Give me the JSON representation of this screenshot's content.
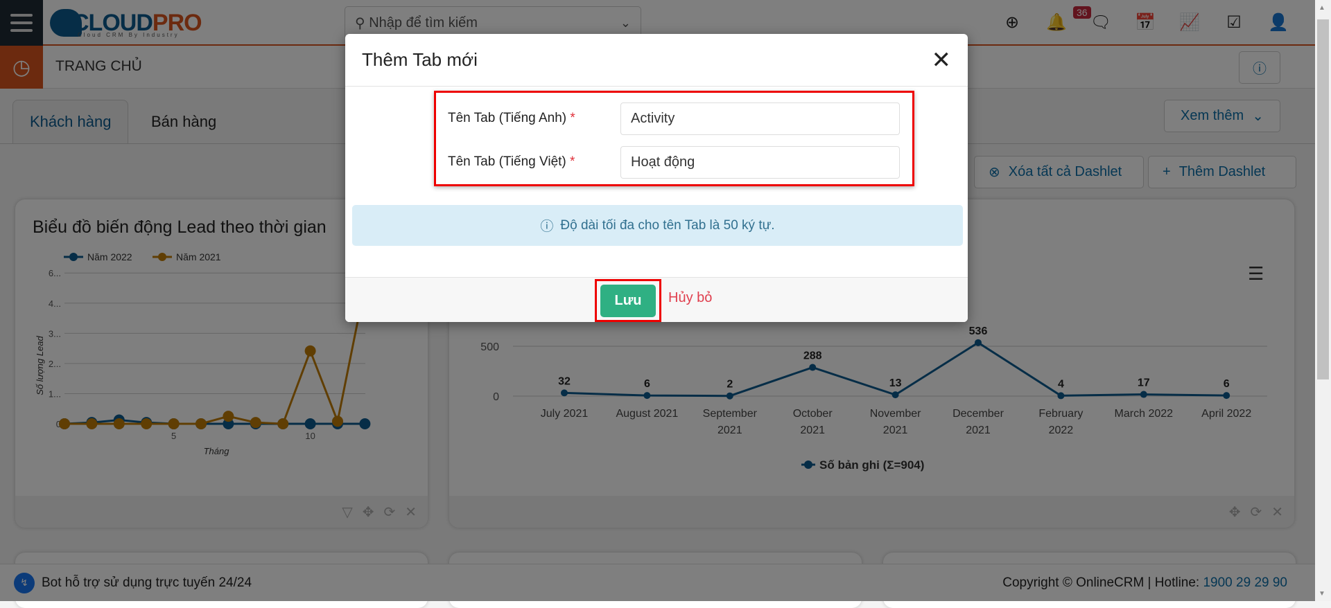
{
  "header": {
    "search_placeholder": "Nhập để tìm kiếm",
    "logo_text_1": "CLOUD",
    "logo_text_2": "PRO",
    "logo_sub": "Cloud CRM By Industry",
    "notification_count": "36",
    "icons": [
      "plus-circle-icon",
      "bell-icon",
      "chat-icon",
      "calendar-icon",
      "report-chart-icon",
      "task-check-icon",
      "user-icon"
    ]
  },
  "page": {
    "title": "TRANG CHỦ",
    "tabs": [
      {
        "label": "Khách hàng",
        "active": true
      },
      {
        "label": "Bán hàng",
        "active": false
      }
    ],
    "more_label": "Xem thêm",
    "clear_dashlets": "Xóa tất cả Dashlet",
    "add_dashlet": "Thêm Dashlet"
  },
  "left_dashlet": {
    "title": "Biểu đồ biến động Lead theo thời gian"
  },
  "chart_data": [
    {
      "type": "line",
      "title": "Biểu đồ biến động Lead theo thời gian",
      "xlabel": "Tháng",
      "ylabel": "Số lượng Lead",
      "x": [
        1,
        2,
        3,
        4,
        5,
        6,
        7,
        8,
        9,
        10,
        11,
        12
      ],
      "xticks": [
        "5",
        "10"
      ],
      "yticks": [
        "0",
        "1...",
        "2...",
        "3...",
        "4...",
        "6..."
      ],
      "ylim": [
        0,
        6
      ],
      "legend": "top-left",
      "grid": true,
      "series": [
        {
          "name": "Năm 2022",
          "color": "#0d5b8f",
          "values": [
            0,
            0.05,
            0.15,
            0.05,
            0,
            0,
            0,
            0,
            0,
            0,
            0,
            0
          ]
        },
        {
          "name": "Năm 2021",
          "color": "#c17d06",
          "values": [
            0,
            0,
            0,
            0,
            0,
            0,
            0.3,
            0.05,
            0,
            2.9,
            0.1,
            5.5
          ]
        }
      ]
    },
    {
      "type": "line",
      "categories": [
        "July 2021",
        "August 2021",
        "September 2021",
        "October 2021",
        "November 2021",
        "December 2021",
        "February 2022",
        "March 2022",
        "April 2022"
      ],
      "yticks": [
        "0",
        "500"
      ],
      "grid": true,
      "legend": "bottom",
      "series": [
        {
          "name": "Số bản ghi (Σ=904)",
          "color": "#0d5b8f",
          "values": [
            32,
            6,
            2,
            288,
            13,
            536,
            4,
            17,
            6
          ]
        }
      ]
    }
  ],
  "footer": {
    "bot": "Bot hỗ trợ sử dụng trực tuyến 24/24",
    "copyright": "Copyright © OnlineCRM | Hotline: ",
    "hotline": "1900 29 29 90"
  },
  "modal": {
    "title": "Thêm Tab mới",
    "label_en": "Tên Tab (Tiếng Anh)",
    "label_vi": "Tên Tab (Tiếng Việt)",
    "required": "*",
    "value_en": "Activity",
    "value_vi": "Hoạt động",
    "info": "Độ dài tối đa cho tên Tab là 50 ký tự.",
    "save": "Lưu",
    "cancel": "Hủy bỏ"
  }
}
